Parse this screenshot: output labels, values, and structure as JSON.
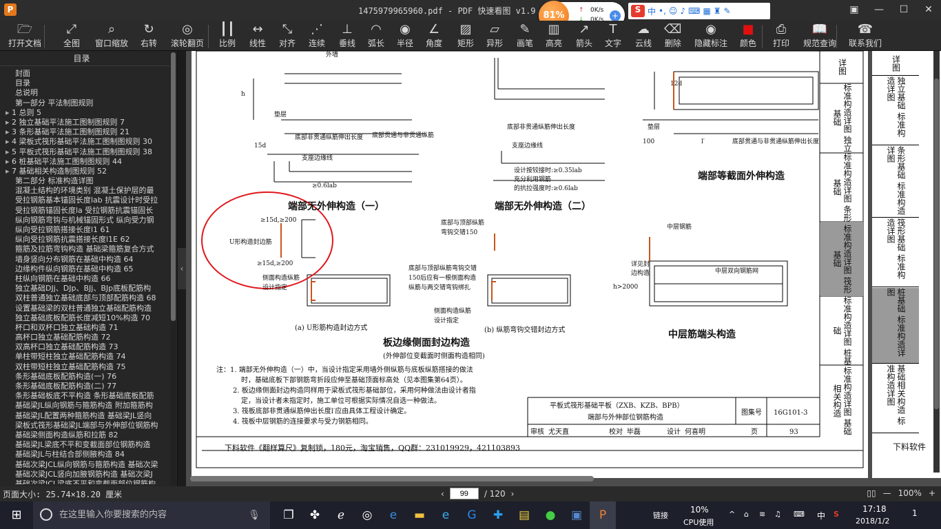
{
  "window": {
    "title": "1475979965960.pdf - PDF 快速看图 v1.9",
    "app_icon": "P"
  },
  "speed": {
    "percent": "81%",
    "up": "0K/s",
    "down": "0K/s"
  },
  "ime": {
    "lang": "中"
  },
  "toolbar": [
    {
      "label": "打开文档",
      "icon": "folder-icon"
    },
    {
      "label": "全图",
      "icon": "fit-icon"
    },
    {
      "label": "窗口缩放",
      "icon": "zoom-icon"
    },
    {
      "label": "右转",
      "icon": "rotate-icon"
    },
    {
      "label": "滚轮翻页",
      "icon": "mouse-icon"
    },
    {
      "label": "比例",
      "icon": "ruler-icon"
    },
    {
      "label": "线性",
      "icon": "linear-icon"
    },
    {
      "label": "对齐",
      "icon": "align-icon"
    },
    {
      "label": "连续",
      "icon": "continuous-icon"
    },
    {
      "label": "垂线",
      "icon": "perp-icon"
    },
    {
      "label": "弧长",
      "icon": "arc-icon"
    },
    {
      "label": "半径",
      "icon": "radius-icon"
    },
    {
      "label": "角度",
      "icon": "angle-icon"
    },
    {
      "label": "矩形",
      "icon": "rect-icon"
    },
    {
      "label": "异形",
      "icon": "shape-icon"
    },
    {
      "label": "画笔",
      "icon": "pen-icon"
    },
    {
      "label": "高亮",
      "icon": "highlight-icon"
    },
    {
      "label": "箭头",
      "icon": "arrow-icon"
    },
    {
      "label": "文字",
      "icon": "text-icon"
    },
    {
      "label": "云线",
      "icon": "cloud-icon"
    },
    {
      "label": "删除",
      "icon": "eraser-icon"
    },
    {
      "label": "隐藏标注",
      "icon": "eye-icon"
    },
    {
      "label": "颜色",
      "icon": "color-icon"
    },
    {
      "label": "打印",
      "icon": "print-icon"
    },
    {
      "label": "规范查询",
      "icon": "book-icon"
    },
    {
      "label": "联系我们",
      "icon": "contact-icon"
    }
  ],
  "sidebar": {
    "title": "目录",
    "items": [
      "封面",
      "目录",
      "总说明",
      "第一部分 平法制图规则",
      "1 总则 5",
      "2 独立基础平法施工图制图规则 7",
      "3 条形基础平法施工图制图规则 21",
      "4 梁板式筏形基础平法施工图制图规则 30",
      "5 平板式筏形基础平法施工图制图规则 38",
      "6 桩基础平法施工图制图规则 44",
      "7 基础相关构造制图规则 52",
      "第二部分 标准构造详图",
      "混凝土结构的环境类别 混凝土保护层的最",
      "受拉钢筋基本锚固长度lab 抗震设计时受拉",
      "受拉钢筋锚固长度la 受拉钢筋抗震锚固长",
      "纵向钢筋弯钩与机械锚固形式 纵向受力钢",
      "纵向受拉钢筋搭接长度l1 61",
      "纵向受拉钢筋抗震搭接长度l1E 62",
      "箍筋及拉筋弯钩构造 基础梁箍筋复合方式",
      "墙身竖向分布钢筋在基础中构造 64",
      "边缘构件纵向钢筋在基础中构造 65",
      "柱纵向钢筋在基础中构造 66",
      "独立基础DJj、DJp、BJj、BJp底板配筋构",
      "双柱普通独立基础底部与顶部配筋构造 68",
      "设置基础梁的双柱普通独立基础配筋构造",
      "独立基础底板配筋长度减短10%构造 70",
      "杯口和双杯口独立基础构造 71",
      "高杯口独立基础配筋构造 72",
      "双高杯口独立基础配筋构造 73",
      "单柱带短柱独立基础配筋构造 74",
      "双柱带短柱独立基础配筋构造 75",
      "条形基础底板配筋构造(一) 76",
      "条形基础底板配筋构造(二) 77",
      "条形基础板底不平构造 条形基础底板配筋",
      "基础梁JL纵向钢筋与箍筋构造 附加箍筋构",
      "基础梁JL配置两种箍筋构造 基础梁JL竖向",
      "梁板式筏形基础梁JL端部与外伸部位钢筋构",
      "基础梁侧面构造纵筋和拉筋 82",
      "基础梁JL梁底不平和变截面部位钢筋构造",
      "基础梁JL与柱结合部侧腋构造 84",
      "基础次梁JCL纵向钢筋与箍筋构造 基础次梁",
      "基础次梁JCL竖向加腋钢筋构造 基础次梁J",
      "基础次梁JCL梁底不平和变截面部位钢筋构"
    ]
  },
  "drawing": {
    "titles": [
      "端部无外伸构造（一）",
      "端部无外伸构造（二）",
      "端部等截面外伸构造",
      "板边缘侧面封边构造",
      "中层筋端头构造"
    ],
    "subtitle_note": "(外伸部位变截面时侧面构造相同)",
    "sub_a": "(a) U形筋构造封边方式",
    "sub_b": "(b) 纵筋弯钩交错封边方式",
    "labels": {
      "outer_wall": "外墙",
      "pad": "垫层",
      "pad2": "垫层",
      "bottom_nonthrough": "底部非贯通纵筋伸出长度",
      "bottom_through": "底部贯通与非贯通纵筋",
      "bottom_nonthrough2": "底部非贯通纵筋伸出长度",
      "bottom_through2": "底部贯通与非贯通纵筋伸出长度",
      "support_line": "支座边缘线",
      "support_line2": "支座边缘线",
      "design_hinge": "设计按铰接时:≥0.35lab",
      "full_use": "充分利用钢筋",
      "tensile": "的抗拉强度时:≥0.6lab",
      "lab06": "≥0.6lab",
      "u_bar": "U形构造封边筋",
      "d15a": "≥15d,≥200",
      "d15b": "≥15d,≥200",
      "side_form": "侧面构造纵筋",
      "design_spec": "设计指定",
      "top_bottom_hook": "底部与顶部纵筋",
      "hook150": "弯钩交错150",
      "cross_note1": "底部与顶部纵筋弯钩交错",
      "cross_note2": "150后应有一根侧面构造",
      "cross_note3": "纵筋与两交错弯钩绑扎",
      "side_form2": "侧面构造纵筋",
      "design_spec2": "设计指定",
      "mid_bar": "中层钢筋",
      "detail_edge": "详见封",
      "edge_construct": "边构造",
      "mid_mesh": "中层双向钢筋网",
      "h2000": "h>2000",
      "d12": "12d",
      "d15": "15d",
      "h": "h",
      "l_prime": "l′",
      "hundred": "100"
    },
    "notes": [
      "注：1. 端部无外伸构造（一）中，当设计指定采用墙外侧纵筋与底板纵筋搭接的做法",
      "时，基础底板下部钢筋弯折段应伸至基础顶面标高处（见本图集第64页）。",
      "2. 板边缘侧面封边构造同样用于梁板式筏形基础部位，采用何种做法由设计者指",
      "定，当设计者未指定时，施工单位可根据实际情况自选一种做法。",
      "3. 筏板底部非贯通纵筋伸出长度l′应由具体工程设计确定。",
      "4. 筏板中层钢筋的连接要求与受力钢筋相同。"
    ],
    "titleblock": {
      "name1": "平板式筏形基础平板（ZXB、KZB、BPB）",
      "name2": "端部与外伸部位钢筋构造",
      "atlas_label": "图集号",
      "atlas": "16G101-3",
      "review": "审核",
      "reviewer": "尤天直",
      "check": "校对",
      "checker": "毕磊",
      "design": "设计",
      "designer": "何喜明",
      "page_label": "页",
      "page": "93"
    },
    "footer": "下料软件《翻样算尺》复制锁，180元，淘宝销售，QQ群：231019929，421103893",
    "side_tabs": [
      "标准构造详图 独立基础",
      "标准构造详图 条形基础",
      "标准构造详图 筏形基础",
      "标准构造详图 桩基础",
      "标准构造详图 基础相关构造"
    ],
    "side_top": "详图",
    "page2_tabs": [
      "独立基础 标准构造详图",
      "条形基础 标准构造详图",
      "筏形基础 标准构造详图",
      "桩基础 标准构造详图",
      "基础相关构造 标准构造详图"
    ],
    "page2_top": "详图",
    "page2_footer": "下料软件"
  },
  "status": {
    "page_size": "页面大小: 25.74×18.20 厘米",
    "current_page": "99",
    "total": "/ 120",
    "zoom": "100%"
  },
  "taskbar": {
    "search_placeholder": "在这里输入你要搜索的内容",
    "link": "链接",
    "cpu": "10%",
    "cpu_label": "CPU使用",
    "lang": "中",
    "time": "17:18",
    "date": "2018/1/2",
    "notif": "1"
  }
}
